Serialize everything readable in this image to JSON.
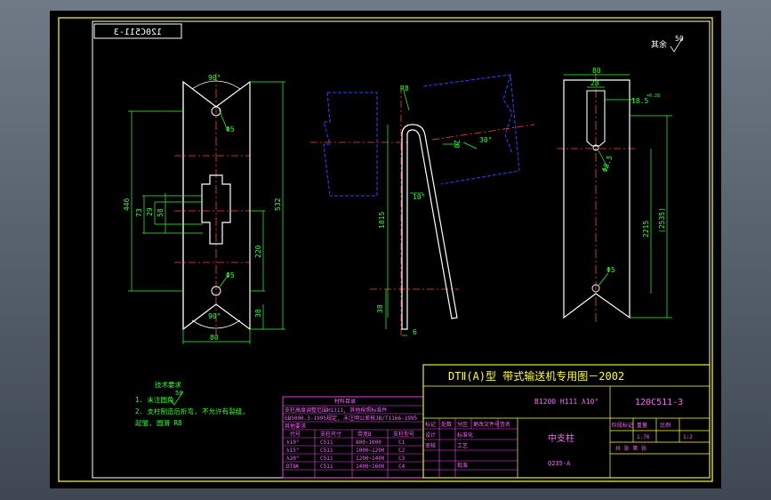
{
  "drawing": {
    "number": "120C511-3",
    "number_mirrored": "120C511-3",
    "roughness_note": "其余",
    "roughness_value": "50"
  },
  "title_block": {
    "title": "DTⅡ(A)型  带式输送机专用图－2002",
    "drawing_no": "120C511-3",
    "spec": "B1200 H111  λ10°",
    "part_name": "中支柱",
    "material_code": "Q235-A",
    "scale_label": "比例",
    "scale": "1:2",
    "weight_label": "重量",
    "weight": "1.76",
    "stage_label": "阶段标记",
    "sheet_label": "共  张  第  张",
    "row_labels": [
      "标记",
      "处数",
      "分区",
      "更改文件号",
      "签名",
      "年.月.日"
    ],
    "role_labels": [
      "设计",
      "标准化",
      "审核",
      "工艺",
      "批准"
    ]
  },
  "notes": {
    "heading": "技术要求",
    "roughness_value": "50",
    "lines": [
      "1. 未注圆角",
      "2. 支柱制造后折弯, 不允许有裂缝,",
      "   起皱, 圆滑 R8"
    ]
  },
  "revision_table": {
    "title": "材料目录",
    "line1": "支柱高度调整范围H1111, 其他按照标准件",
    "line2": "GB5000.3-1995规定, 未注明公差按JB/T1166-1995",
    "line3": "其他要求",
    "col_headers": [
      "代号",
      "支柱尺寸",
      "带宽B",
      "支柱型号"
    ],
    "rows": [
      [
        "λ10°",
        "C511",
        "800~1000",
        "C1"
      ],
      [
        "λ15°",
        "C511",
        "1000~1200",
        "C2"
      ],
      [
        "λ20°",
        "C511",
        "1200~1400",
        "C3"
      ],
      [
        "DTⅡA",
        "C511",
        "1400~1600",
        "C4"
      ]
    ]
  },
  "dimensions": {
    "angle_top": "90°",
    "angle_bottom": "90°",
    "height_overall": "446",
    "height_right": "532",
    "slot_a": "73",
    "slot_b": "29",
    "slot_c": "58",
    "span_mid": "220",
    "span_bottom": "38",
    "width_left": "80",
    "hole_top": "Φ5",
    "hole_bottom": "Φ5",
    "side_radius": "R8",
    "side_hole": "Φ5",
    "side_width": "20",
    "side_angle": "30°",
    "side_angle2": "10°",
    "side_height": "1815",
    "side_base": "38",
    "side_thick": "6",
    "right_width": "80",
    "right_top": "28",
    "right_tol": "18.5",
    "right_tol_sup": "+0.28",
    "right_hole": "Φ8.5",
    "right_hole2": "Φ5",
    "right_h1": "2215",
    "right_h2": "(2535)"
  }
}
